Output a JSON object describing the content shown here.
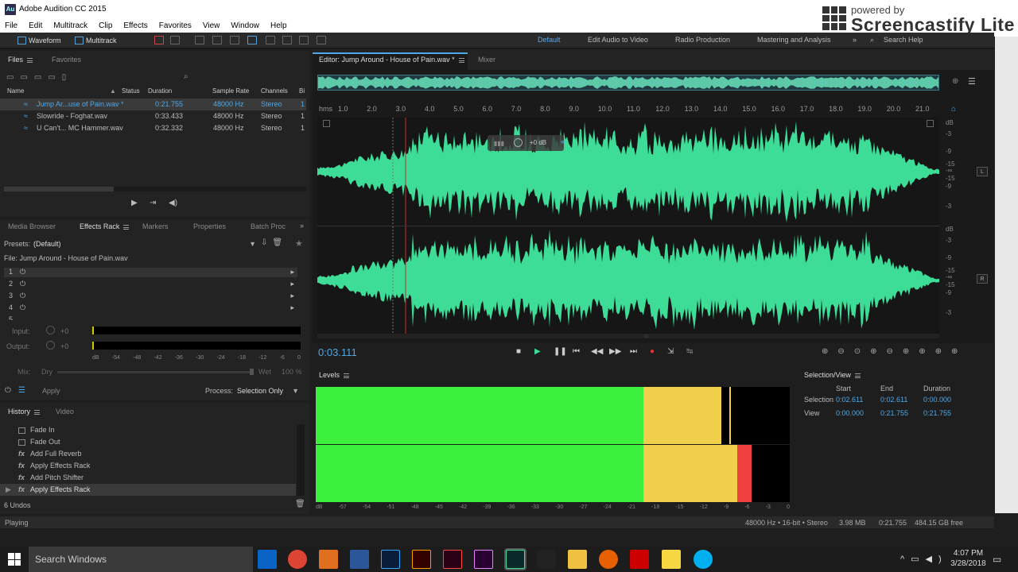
{
  "window": {
    "title": "Adobe Audition CC 2015",
    "app_icon": "Au"
  },
  "watermark": {
    "line1": "powered by",
    "line2": "Screencastify Lite"
  },
  "menu": [
    "File",
    "Edit",
    "Multitrack",
    "Clip",
    "Effects",
    "Favorites",
    "View",
    "Window",
    "Help"
  ],
  "toolbar": {
    "waveform_label": "Waveform",
    "multitrack_label": "Multitrack",
    "workspaces": [
      "Default",
      "Edit Audio to Video",
      "Radio Production",
      "Mastering and Analysis"
    ],
    "search_label": "Search Help"
  },
  "files": {
    "tabs": [
      "Files",
      "Favorites"
    ],
    "columns": [
      "Name",
      "Status",
      "Duration",
      "Sample Rate",
      "Channels",
      "Bi"
    ],
    "rows": [
      {
        "name": "Jump Ar...use of Pain.wav *",
        "duration": "0:21.755",
        "rate": "48000 Hz",
        "channels": "Stereo",
        "bits": "1"
      },
      {
        "name": "Slowride - Foghat.wav",
        "duration": "0:33.433",
        "rate": "48000 Hz",
        "channels": "Stereo",
        "bits": "1"
      },
      {
        "name": "U Can't... MC Hammer.wav",
        "duration": "0:32.332",
        "rate": "48000 Hz",
        "channels": "Stereo",
        "bits": "1"
      }
    ]
  },
  "rack": {
    "tabs": [
      "Media Browser",
      "Effects Rack",
      "Markers",
      "Properties",
      "Batch Proc"
    ],
    "presets_label": "Presets:",
    "presets_value": "(Default)",
    "file_label": "File: Jump Around - House of Pain.wav",
    "slots": [
      "1",
      "2",
      "3",
      "4",
      "5"
    ],
    "input_label": "Input:",
    "output_label": "Output:",
    "gain": "+0",
    "meter_ticks": [
      "dB",
      "-54",
      "-48",
      "-42",
      "-36",
      "-30",
      "-24",
      "-18",
      "-12",
      "-6",
      "0"
    ],
    "mix_label": "Mix:",
    "dry": "Dry",
    "wet": "Wet",
    "wet_pct": "100 %",
    "apply": "Apply",
    "process_label": "Process:",
    "process_value": "Selection Only"
  },
  "history": {
    "tabs": [
      "History",
      "Video"
    ],
    "items": [
      "Fade In",
      "Fade Out",
      "Add Full Reverb",
      "Apply Effects Rack",
      "Add Pitch Shifter",
      "Apply Effects Rack"
    ],
    "undos": "6 Undos"
  },
  "editor": {
    "tabs": [
      "Editor: Jump Around - House of Pain.wav *",
      "Mixer"
    ],
    "ruler": [
      "hms",
      "1.0",
      "2.0",
      "3.0",
      "4.0",
      "5.0",
      "6.0",
      "7.0",
      "8.0",
      "9.0",
      "10.0",
      "11.0",
      "12.0",
      "13.0",
      "14.0",
      "15.0",
      "16.0",
      "17.0",
      "18.0",
      "19.0",
      "20.0",
      "21.0"
    ],
    "hud_gain": "+0 dB",
    "db_top": [
      "dB",
      "-3",
      "-9",
      "-15",
      "-∞",
      "-15",
      "-9",
      "-3"
    ],
    "db_bottom": [
      "dB",
      "-3",
      "-9",
      "-15",
      "-∞",
      "-15",
      "-9",
      "-3"
    ],
    "ch_left": "L",
    "ch_right": "R",
    "time": "0:03.111"
  },
  "levels": {
    "title": "Levels",
    "ticks": [
      "dB",
      "-57",
      "-54",
      "-51",
      "-48",
      "-45",
      "-42",
      "-39",
      "-36",
      "-33",
      "-30",
      "-27",
      "-24",
      "-21",
      "-18",
      "-15",
      "-12",
      "-9",
      "-6",
      "-3",
      "0"
    ]
  },
  "selview": {
    "title": "Selection/View",
    "headers": [
      "Start",
      "End",
      "Duration"
    ],
    "selection": {
      "label": "Selection",
      "start": "0:02.611",
      "end": "0:02.611",
      "dur": "0:00.000"
    },
    "view": {
      "label": "View",
      "start": "0:00.000",
      "end": "0:21.755",
      "dur": "0:21.755"
    }
  },
  "status": {
    "left": "Playing",
    "format": "48000 Hz • 16-bit • Stereo",
    "size": "3.98 MB",
    "duration": "0:21.755",
    "free": "484.15 GB free"
  },
  "taskbar": {
    "search": "Search Windows",
    "time": "4:07 PM",
    "date": "3/28/2018"
  },
  "colors": {
    "accent": "#4fa8e8",
    "wave": "#3ddc97",
    "meter_green": "#3ef03e",
    "meter_yellow": "#f0d04a",
    "meter_red": "#f04040"
  }
}
